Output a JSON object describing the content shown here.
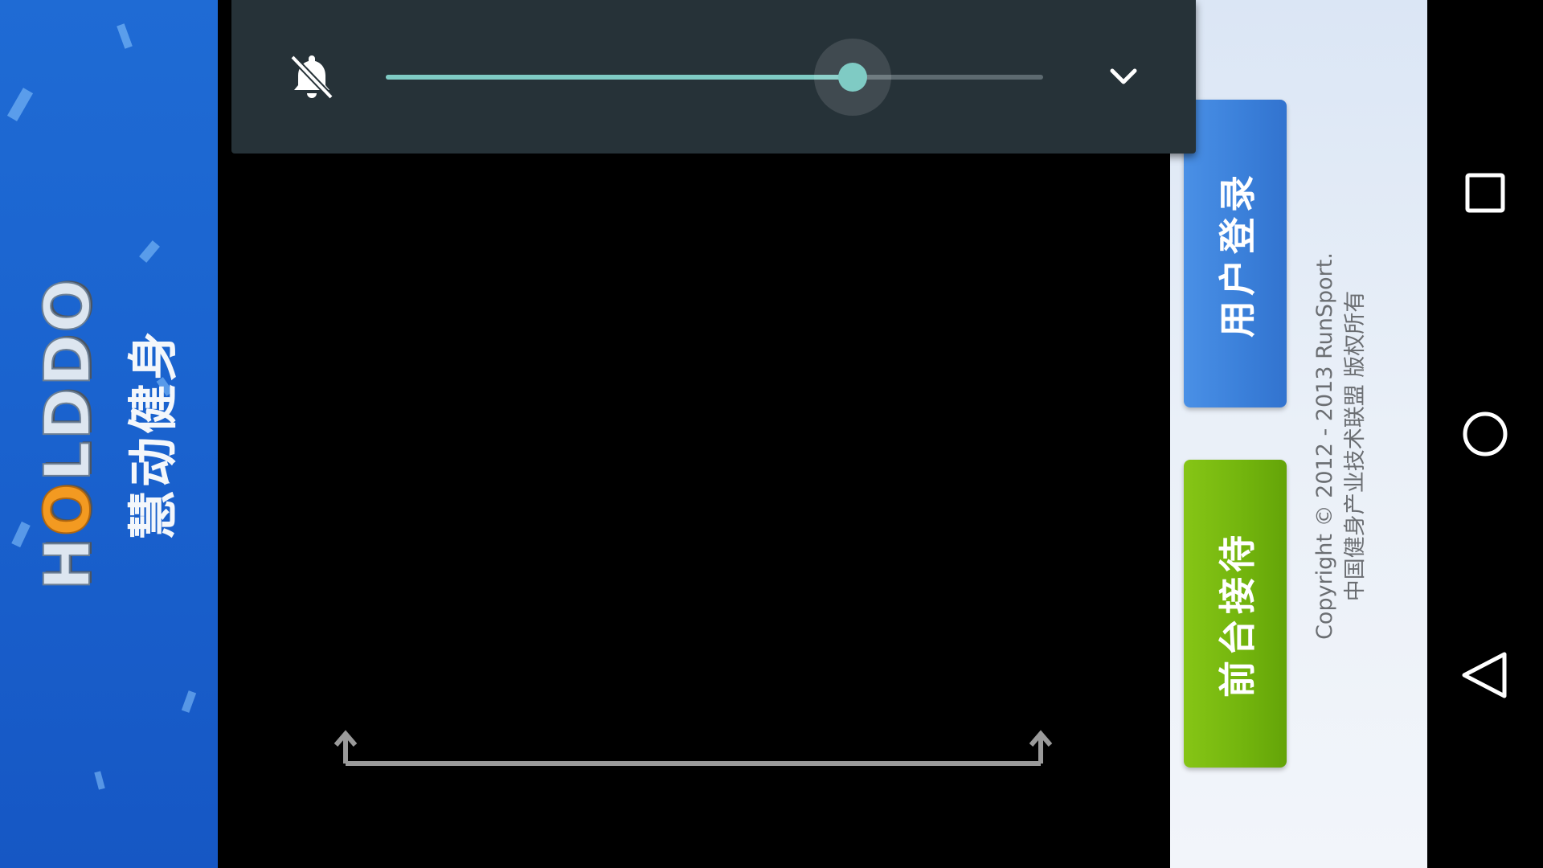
{
  "brand": {
    "logo_prefix": "H",
    "logo_o": "O",
    "logo_suffix": "LDDO",
    "name_cn": "慧动健身"
  },
  "actions": {
    "login_label": "用户登录",
    "reception_label": "前台接待"
  },
  "copyright": {
    "line1": "Copyright © 2012 - 2013 RunSport.",
    "line2": "中国健身产业技术联盟 版权所有"
  },
  "volume_dialog": {
    "icon": "bell-off-icon",
    "level": 0.71,
    "expand_icon": "chevron-down-icon"
  },
  "navigation": {
    "recents_icon": "square-icon",
    "home_icon": "circle-icon",
    "back_icon": "triangle-back-icon"
  },
  "colors": {
    "brand_blue": "#1a63cf",
    "login_blue": "#3a7fd9",
    "reception_green": "#72b40d",
    "volume_bg": "#263238",
    "slider_accent": "#7fcbc4"
  }
}
